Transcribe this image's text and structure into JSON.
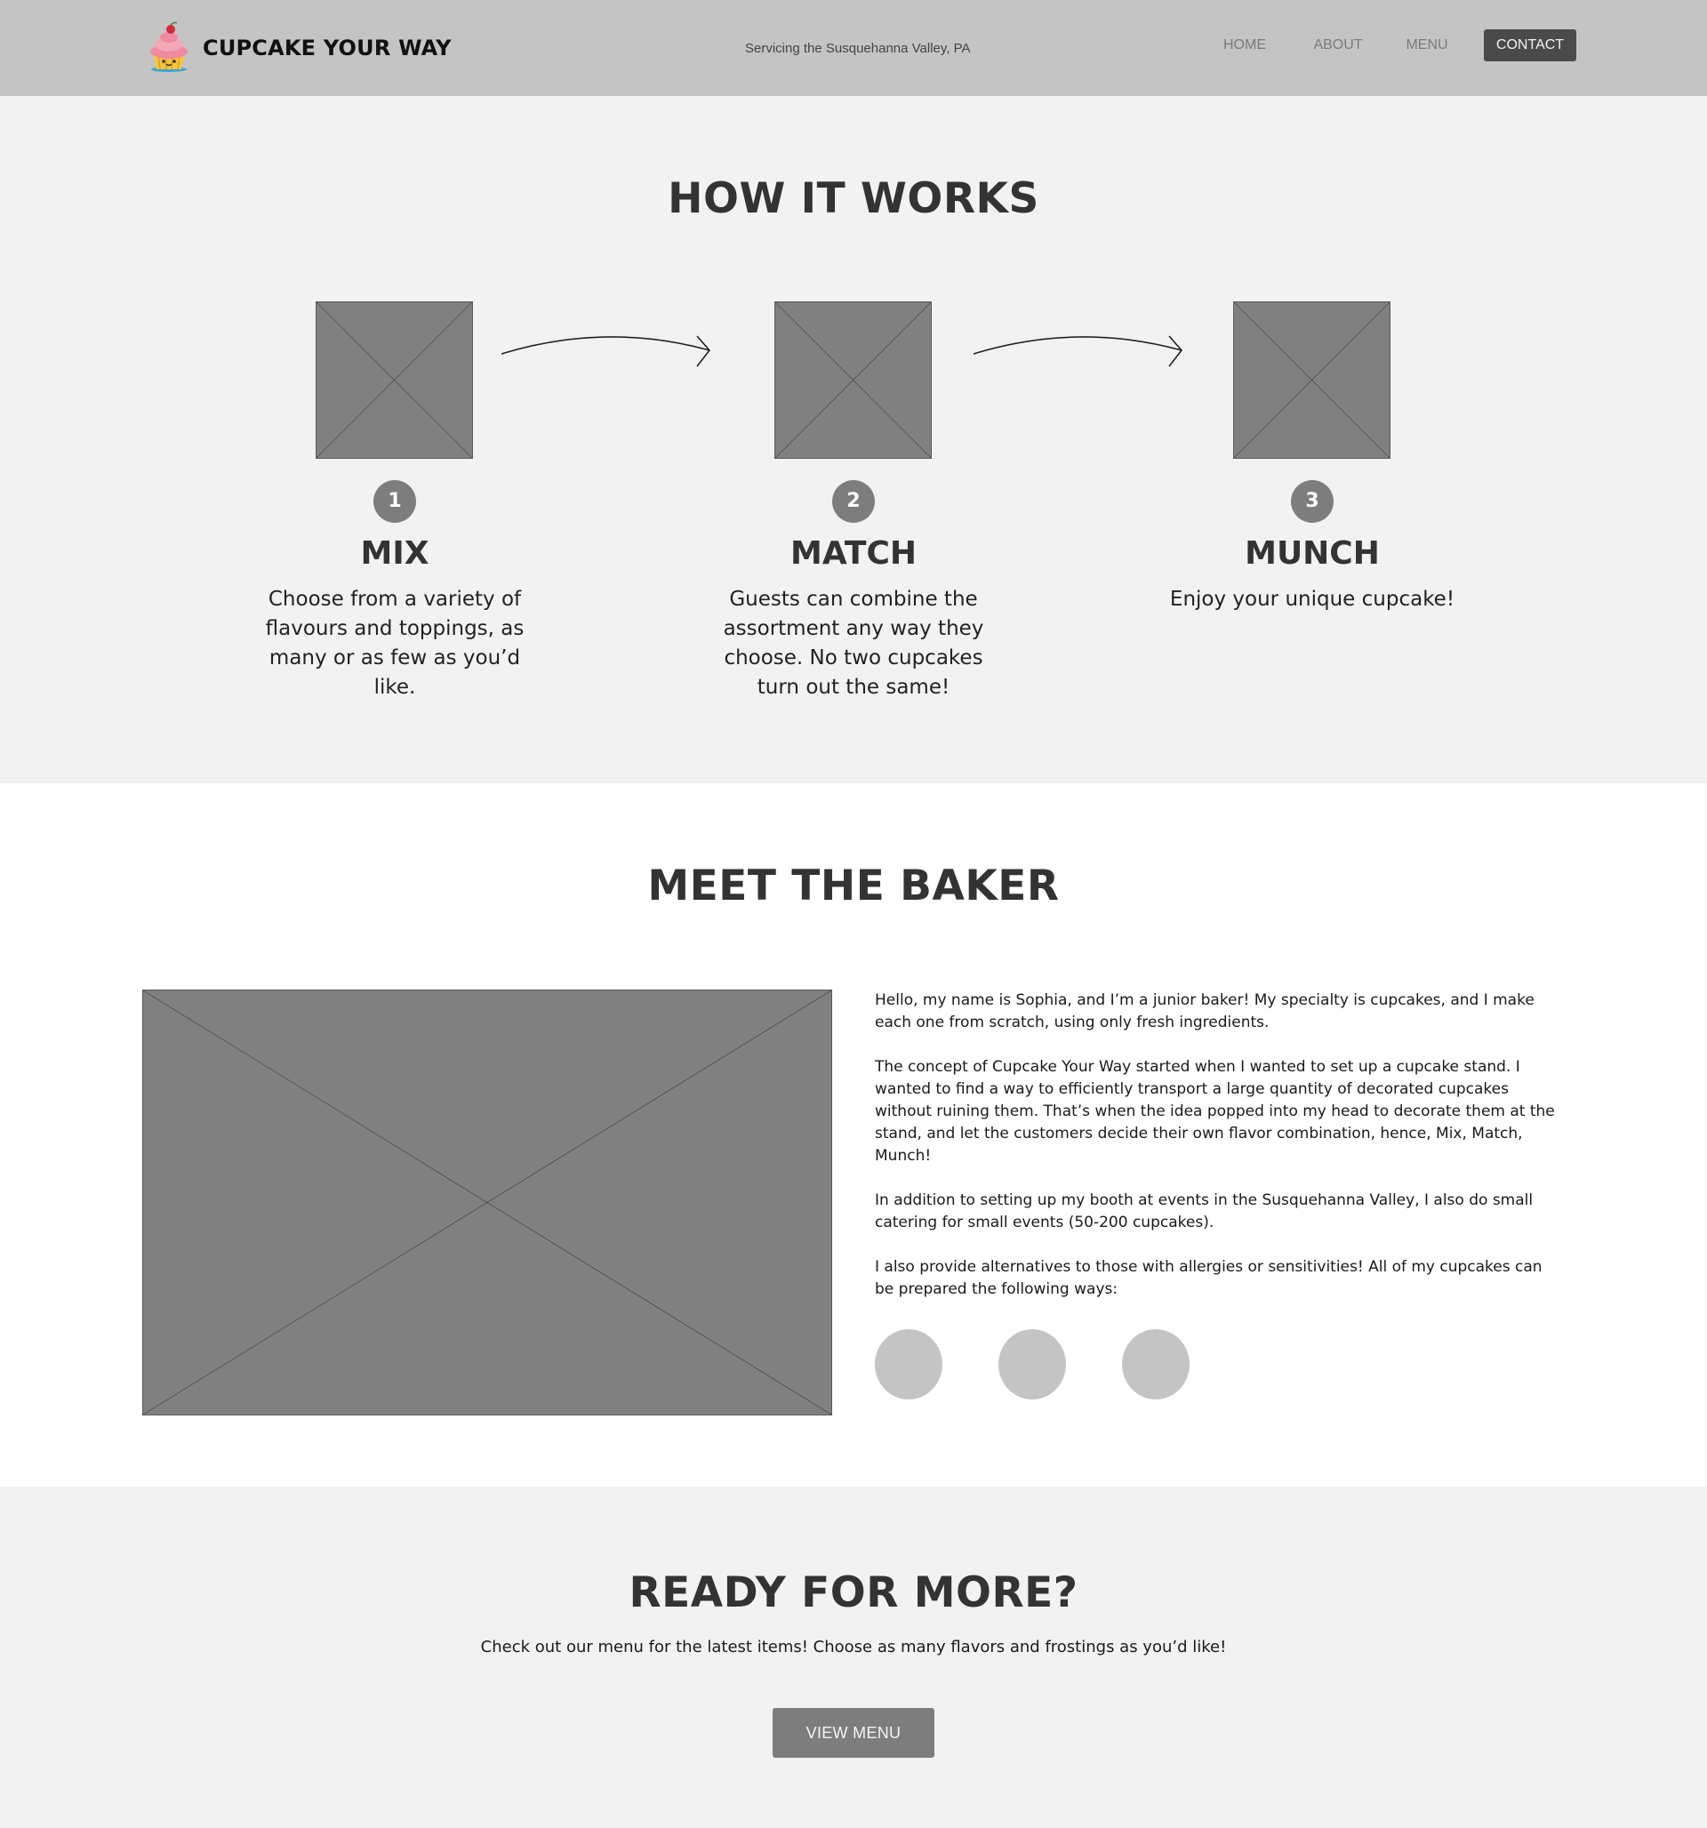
{
  "header": {
    "brand": "CUPCAKE YOUR WAY",
    "logo_icon": "cupcake-logo-icon",
    "tagline": "Servicing the Susquehanna Valley, PA",
    "nav": {
      "home": "HOME",
      "about": "ABOUT",
      "menu": "MENU",
      "contact": "CONTACT"
    }
  },
  "how_it_works": {
    "title": "HOW IT WORKS",
    "steps": [
      {
        "number": "1",
        "title": "MIX",
        "description": "Choose from a variety of flavours and toppings, as many or as few as you’d like."
      },
      {
        "number": "2",
        "title": "MATCH",
        "description": "Guests can combine the assortment any way they choose. No two cupcakes turn out the same!"
      },
      {
        "number": "3",
        "title": "MUNCH",
        "description": "Enjoy your unique cupcake!"
      }
    ]
  },
  "meet_the_baker": {
    "title": "MEET THE BAKER",
    "paragraphs": [
      "Hello, my name is Sophia, and I’m a junior baker! My specialty is cupcakes, and I make each one from scratch, using only fresh ingredients.",
      "The concept of Cupcake Your Way started when I wanted to set up a cupcake stand. I wanted to find a way to efficiently transport a large quantity of decorated cupcakes without ruining them. That’s when the idea popped into my head to decorate them at the stand, and let the customers decide their own flavor combination, hence, Mix, Match, Munch!",
      "In addition to setting up my booth at events in the Susquehanna Valley, I also do small catering for small events (50-200 cupcakes).",
      "I also provide alternatives to those with allergies or sensitivities! All of my cupcakes can be prepared the following ways:"
    ]
  },
  "ready_for_more": {
    "title": "READY FOR MORE?",
    "text": "Check out our menu for the latest items! Choose as many flavors and frostings as you’d like!",
    "button": "VIEW MENU"
  },
  "colors": {
    "header_bg": "#c4c4c4",
    "section_alt_bg": "#f2f2f2",
    "placeholder": "#808080",
    "button": "#7d7d7d",
    "contact_button": "#4a4a4a"
  }
}
